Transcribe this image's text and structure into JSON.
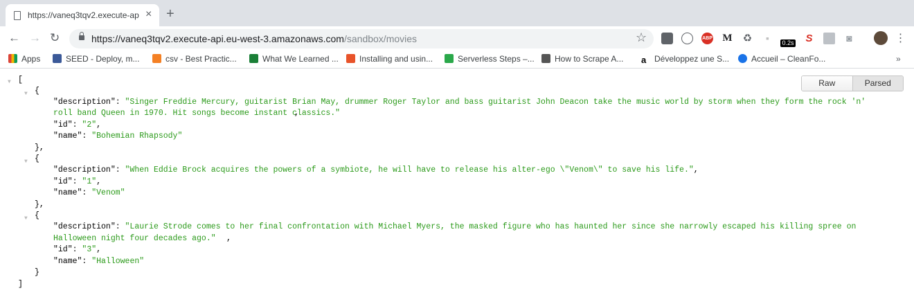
{
  "tab": {
    "title": "https://vaneq3tqv2.execute-ap",
    "close": "×"
  },
  "url": {
    "host": "https://vaneq3tqv2.execute-api.eu-west-3.amazonaws.com",
    "path": "/sandbox/movies"
  },
  "bookmarks": [
    {
      "label": "Apps",
      "color": "#db4437"
    },
    {
      "label": "SEED - Deploy, m...",
      "color": "#3b5998"
    },
    {
      "label": "csv - Best Practic...",
      "color": "#f48024"
    },
    {
      "label": "What We Learned ...",
      "color": "#1a7f37"
    },
    {
      "label": "Installing and usin...",
      "color": "#e8532a"
    },
    {
      "label": "Serverless Steps –...",
      "color": "#2aa84a"
    },
    {
      "label": "How to Scrape A...",
      "color": "#555555"
    },
    {
      "label": "Développez une S...",
      "color": "#000000"
    },
    {
      "label": "Accueil – CleanFo...",
      "color": "#1a73e8"
    }
  ],
  "more_bookmarks": "»",
  "toggle": {
    "raw": "Raw",
    "parsed": "Parsed"
  },
  "extensions": {
    "timer_badge": "0.2s"
  },
  "movies": [
    {
      "description_line1": "\"Singer Freddie Mercury, guitarist Brian May, drummer Roger Taylor and bass guitarist John Deacon take the music world by storm when they form the rock 'n'",
      "description_line2": "roll band Queen in 1970. Hit songs become instant classics.\"",
      "id": "\"2\"",
      "name": "\"Bohemian Rhapsody\""
    },
    {
      "description_line1": "\"When Eddie Brock acquires the powers of a symbiote, he will have to release his alter-ego \\\"Venom\\\" to save his life.\"",
      "description_line2": "",
      "id": "\"1\"",
      "name": "\"Venom\""
    },
    {
      "description_line1": "\"Laurie Strode comes to her final confrontation with Michael Myers, the masked figure who has haunted her since she narrowly escaped his killing spree on",
      "description_line2": "Halloween night four decades ago.\"",
      "id": "\"3\"",
      "name": "\"Halloween\""
    }
  ],
  "keys": {
    "description": "\"description\"",
    "id": "\"id\"",
    "name": "\"name\""
  }
}
